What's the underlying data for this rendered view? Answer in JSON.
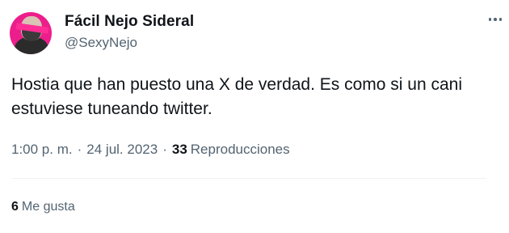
{
  "author": {
    "display_name": "Fácil Nejo Sideral",
    "handle": "@SexyNejo"
  },
  "tweet": {
    "text": "Hostia que han puesto una X de verdad. Es como si un cani estuviese tuneando twitter.",
    "time": "1:00 p. m.",
    "separator": "·",
    "date": "24 jul. 2023",
    "views_count": "33",
    "views_label": "Reproducciones",
    "likes_count": "6",
    "likes_label": "Me gusta"
  },
  "icons": {
    "more": "more-horizontal-icon",
    "avatar": "profile-avatar"
  },
  "colors": {
    "avatar_bg": "#ec1e8c",
    "secondary_text": "#536471",
    "primary_text": "#0f1419",
    "divider": "#eff3f4"
  }
}
